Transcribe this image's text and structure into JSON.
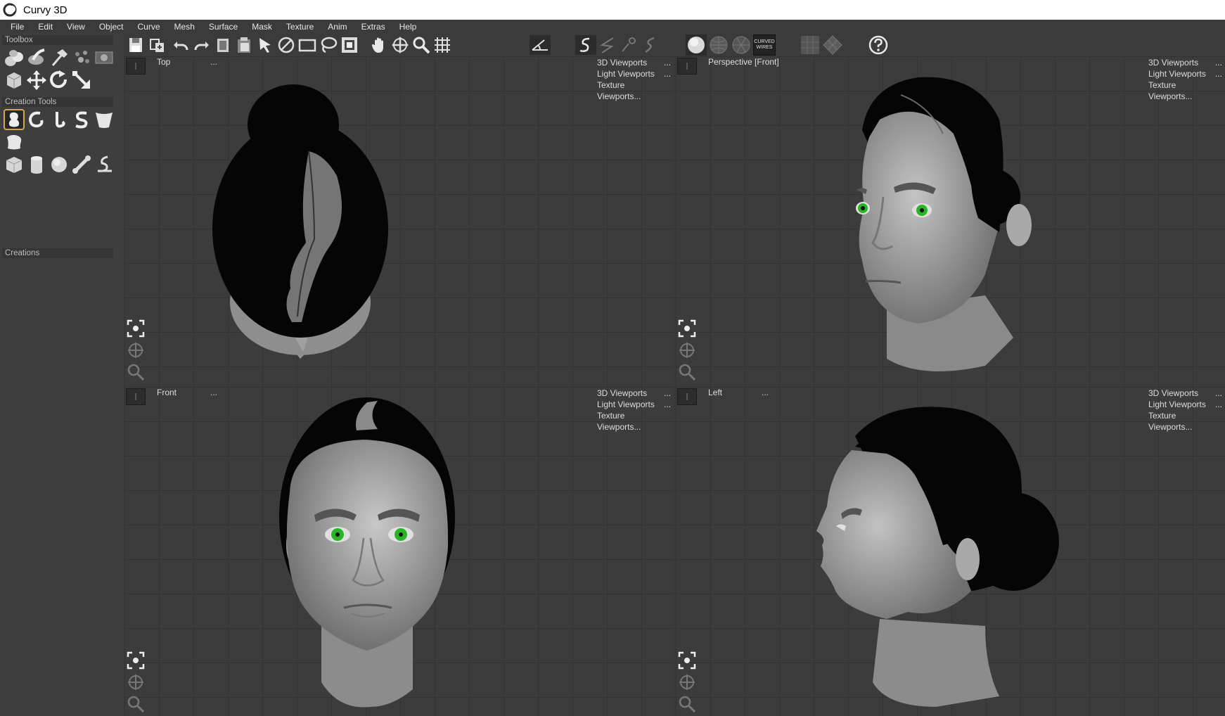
{
  "window": {
    "title": "Curvy 3D"
  },
  "menubar": {
    "items": [
      "File",
      "Edit",
      "View",
      "Object",
      "Curve",
      "Mesh",
      "Surface",
      "Mask",
      "Texture",
      "Anim",
      "Extras",
      "Help"
    ]
  },
  "toolbar": {
    "curved_wires_label_1": "CURVED",
    "curved_wires_label_2": "WIRES",
    "icons": [
      "save-icon",
      "export-icon",
      "undo-icon",
      "redo-icon",
      "copy-icon",
      "paste-icon",
      "select-arrow-icon",
      "deselect-icon",
      "rectangle-select-icon",
      "lasso-icon",
      "mask-select-icon",
      "pan-hand-icon",
      "move-icon",
      "zoom-icon",
      "grid-icon",
      "measure-icon",
      "curve-s-icon",
      "curve-line-icon",
      "curve-pen-icon",
      "curve-edit-icon",
      "shaded-sphere-icon",
      "wire-sphere-icon",
      "textured-sphere-icon",
      "curved-wires-icon",
      "grid-view-icon",
      "view-cube-icon",
      "help-icon"
    ]
  },
  "left_panel": {
    "toolbox_label": "Toolbox",
    "creation_tools_label": "Creation Tools",
    "creations_label": "Creations"
  },
  "viewports": [
    {
      "name": "Top",
      "ellipsis": "...",
      "menu": [
        "3D Viewports",
        "Light Viewports",
        "Texture Viewports..."
      ]
    },
    {
      "name": "Perspective [Front]",
      "ellipsis": "",
      "menu": [
        "3D Viewports",
        "Light Viewports",
        "Texture Viewports..."
      ]
    },
    {
      "name": "Front",
      "ellipsis": "...",
      "menu": [
        "3D Viewports",
        "Light Viewports",
        "Texture Viewports..."
      ]
    },
    {
      "name": "Left",
      "ellipsis": "...",
      "menu": [
        "3D Viewports",
        "Light Viewports",
        "Texture Viewports..."
      ]
    }
  ],
  "menu_dots": "...",
  "colors": {
    "accent_selection": "#d3a74d",
    "eye_green": "#27b527",
    "background": "#3c3c3c"
  }
}
